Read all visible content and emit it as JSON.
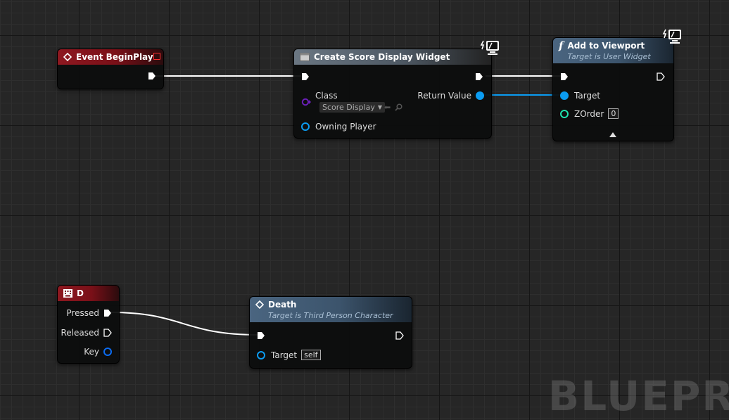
{
  "nodes": {
    "begin_play": {
      "title": "Event BeginPlay"
    },
    "create_widget": {
      "title": "Create Score Display Widget",
      "class_label": "Class",
      "class_value": "Score Display",
      "return_label": "Return Value",
      "owning_label": "Owning Player"
    },
    "add_viewport": {
      "title": "Add to Viewport",
      "subtitle": "Target is User Widget",
      "target_label": "Target",
      "zorder_label": "ZOrder",
      "zorder_value": "0"
    },
    "key_d": {
      "title": "D",
      "pressed_label": "Pressed",
      "released_label": "Released",
      "key_label": "Key"
    },
    "death": {
      "title": "Death",
      "subtitle": "Target is Third Person Character",
      "target_label": "Target",
      "target_value": "self"
    }
  },
  "watermark": "BLUEPRIN",
  "colors": {
    "exec": "#ffffff",
    "object_pin": "#0b9cf2",
    "class_pin": "#5a189c",
    "int_pin": "#1fe3af",
    "event_header": "#7a1018",
    "function_header": "#3c546c"
  },
  "icons": [
    "event-diamond-icon",
    "function-f-icon",
    "widget-icon",
    "keyboard-icon",
    "screen-icon",
    "browse-arrow-icon",
    "search-icon",
    "advanced-arrow-icon"
  ]
}
